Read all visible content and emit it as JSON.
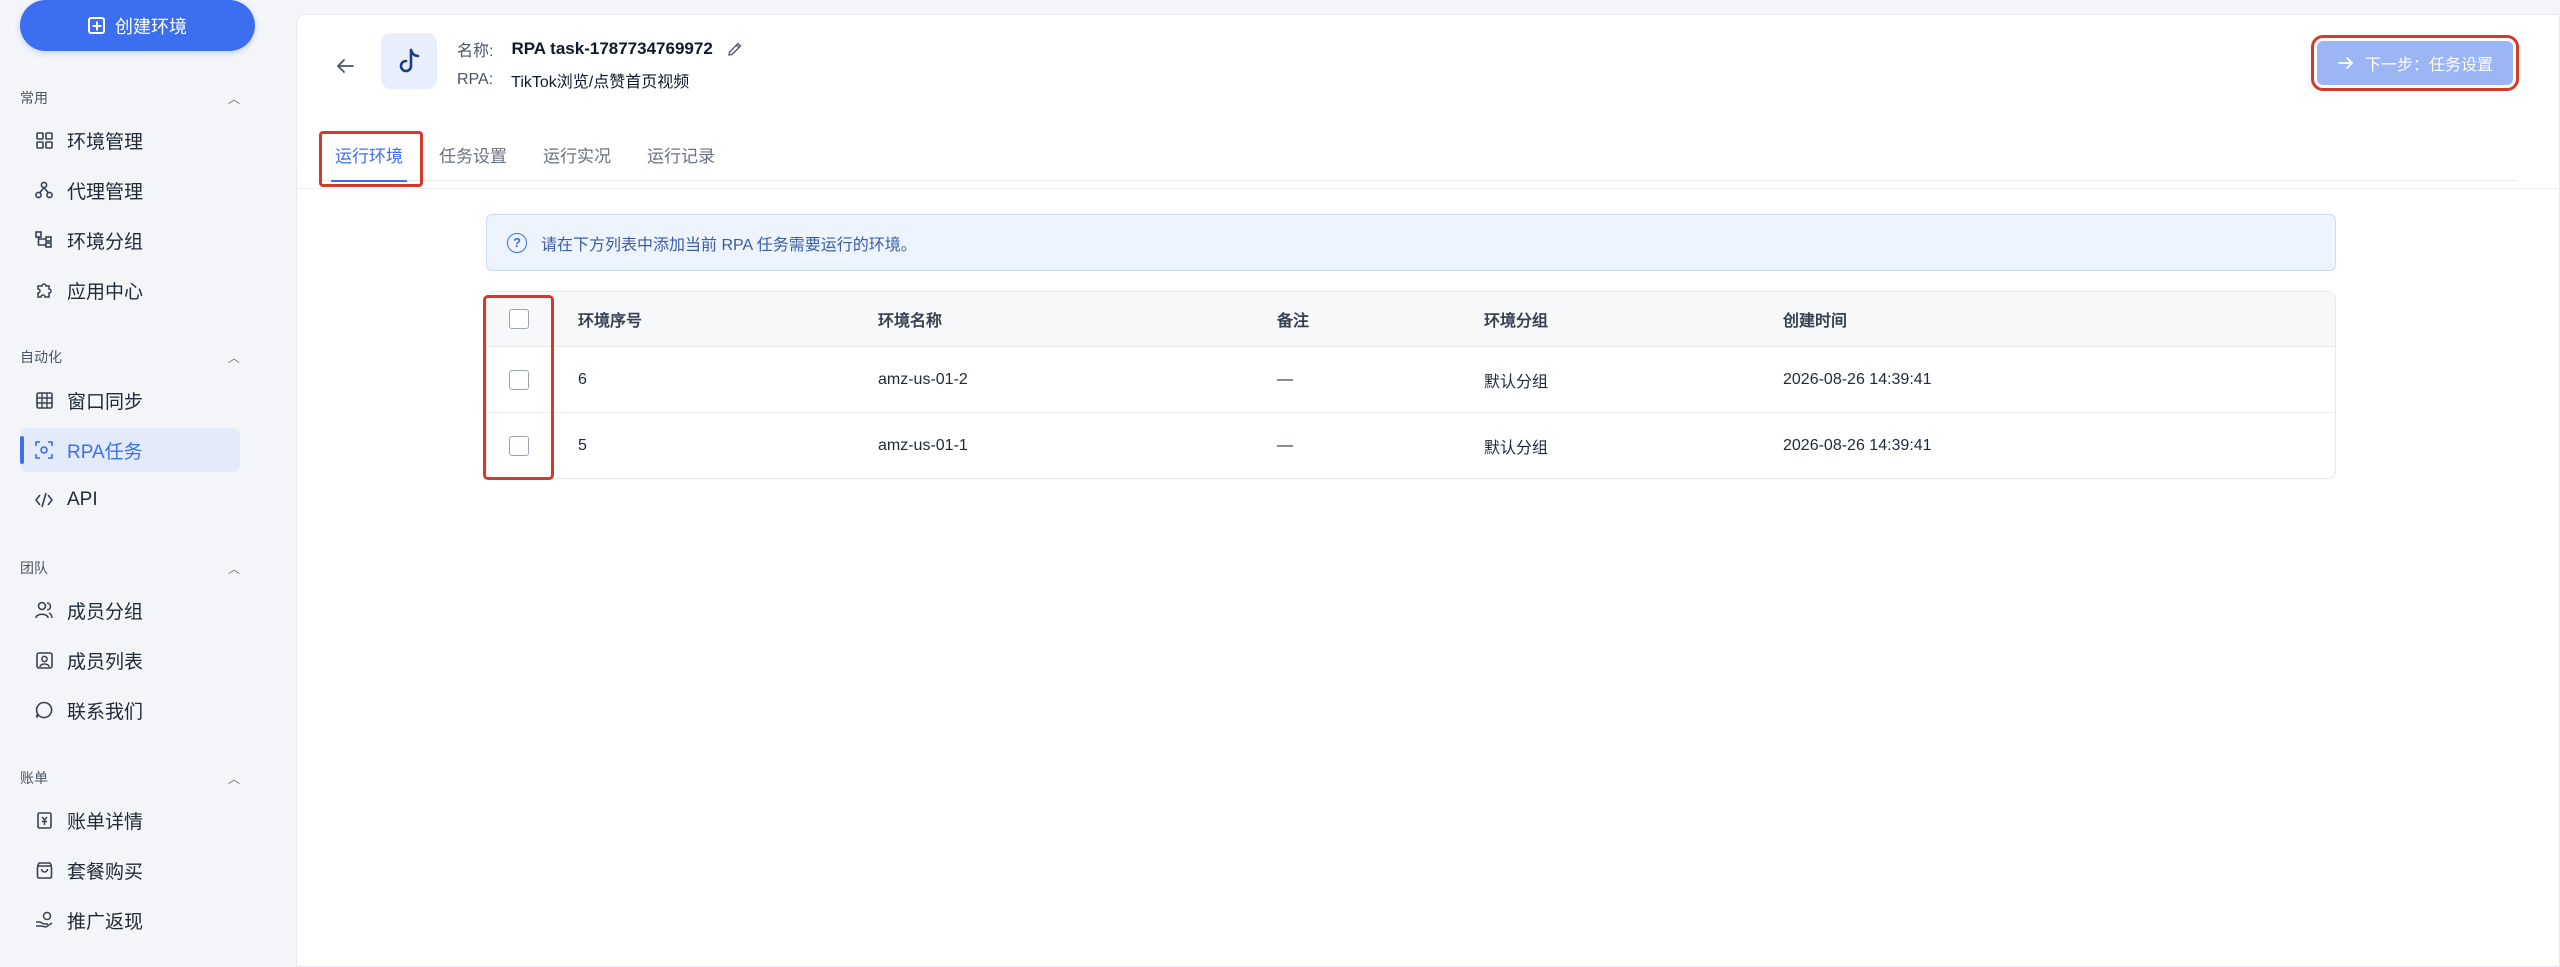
{
  "sidebar": {
    "create_label": "创建环境",
    "sections": [
      {
        "title": "常用",
        "items": [
          {
            "label": "环境管理",
            "icon": "grid-icon"
          },
          {
            "label": "代理管理",
            "icon": "network-icon"
          },
          {
            "label": "环境分组",
            "icon": "tree-icon"
          },
          {
            "label": "应用中心",
            "icon": "puzzle-icon"
          }
        ]
      },
      {
        "title": "自动化",
        "items": [
          {
            "label": "窗口同步",
            "icon": "table-icon"
          },
          {
            "label": "RPA任务",
            "icon": "rpa-icon"
          },
          {
            "label": "API",
            "icon": "code-icon"
          }
        ]
      },
      {
        "title": "团队",
        "items": [
          {
            "label": "成员分组",
            "icon": "users-icon"
          },
          {
            "label": "成员列表",
            "icon": "user-card-icon"
          },
          {
            "label": "联系我们",
            "icon": "chat-icon"
          }
        ]
      },
      {
        "title": "账单",
        "items": [
          {
            "label": "账单详情",
            "icon": "bill-icon"
          },
          {
            "label": "套餐购买",
            "icon": "bag-icon"
          },
          {
            "label": "推广返现",
            "icon": "hand-coin-icon"
          }
        ]
      }
    ],
    "active_item": "RPA任务"
  },
  "header": {
    "name_label": "名称:",
    "name_value": "RPA task-1787734769972",
    "rpa_label": "RPA:",
    "rpa_value": "TikTok浏览/点赞首页视频",
    "next_button": "下一步：任务设置"
  },
  "tabs": [
    "运行环境",
    "任务设置",
    "运行实况",
    "运行记录"
  ],
  "active_tab": "运行环境",
  "info_text": "请在下方列表中添加当前 RPA 任务需要运行的环境。",
  "table": {
    "columns": [
      "环境序号",
      "环境名称",
      "备注",
      "环境分组",
      "创建时间"
    ],
    "rows": [
      {
        "num": "6",
        "name": "amz-us-01-2",
        "note": "—",
        "group": "默认分组",
        "time": "2026-08-26 14:39:41"
      },
      {
        "num": "5",
        "name": "amz-us-01-1",
        "note": "—",
        "group": "默认分组",
        "time": "2026-08-26 14:39:41"
      }
    ]
  },
  "colors": {
    "accent": "#3b6ff0",
    "highlight": "#d23b2a",
    "next_button_bg": "#9bb5f5"
  }
}
